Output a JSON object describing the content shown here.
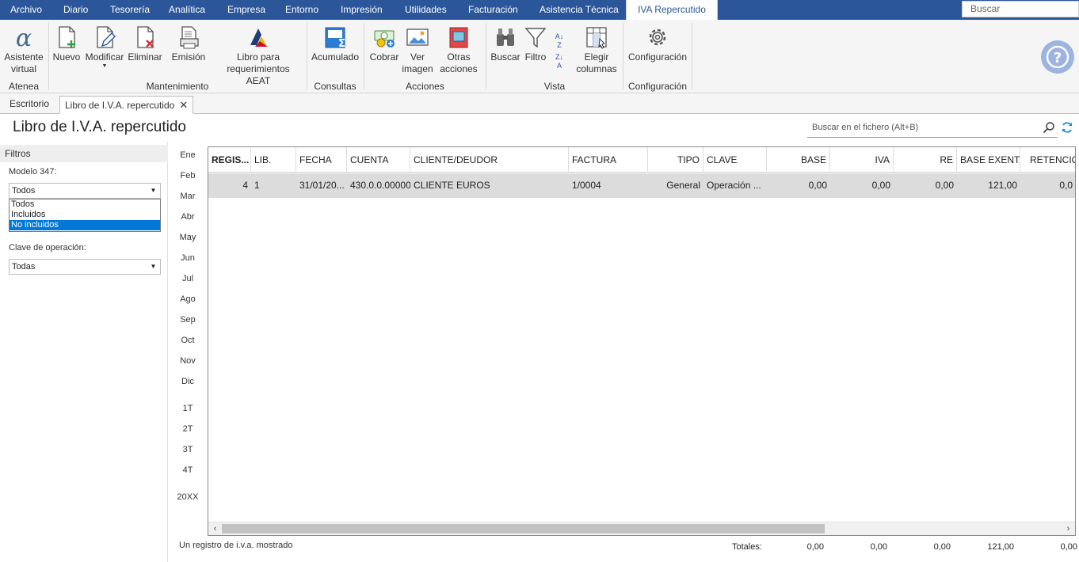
{
  "menu": {
    "items": [
      "Archivo",
      "Diario",
      "Tesorería",
      "Analítica",
      "Empresa",
      "Entorno",
      "Impresión",
      "Utilidades",
      "Facturación",
      "Asistencia Técnica"
    ],
    "active": "IVA Repercutido",
    "search_placeholder": "Buscar"
  },
  "ribbon": {
    "asistente": "Asistente virtual",
    "nuevo": "Nuevo",
    "modificar": "Modificar",
    "eliminar": "Eliminar",
    "emision": "Emisión",
    "libro_aeat": "Libro para requerimientos AEAT",
    "acumulado": "Acumulado",
    "cobrar": "Cobrar",
    "ver_imagen": "Ver imagen",
    "otras_acciones": "Otras acciones",
    "buscar": "Buscar",
    "filtro": "Filtro",
    "elegir_columnas": "Elegir columnas",
    "configuracion": "Configuración",
    "groups": {
      "atenea": "Atenea",
      "mantenimiento": "Mantenimiento",
      "consultas": "Consultas",
      "acciones": "Acciones",
      "vista": "Vista",
      "configuracion": "Configuración"
    }
  },
  "tabs": {
    "escritorio": "Escritorio",
    "libro": "Libro de I.V.A. repercutido"
  },
  "page": {
    "title": "Libro de I.V.A. repercutido",
    "file_search": "Buscar en el fichero (Alt+B)"
  },
  "filters": {
    "header": "Filtros",
    "modelo_label": "Modelo 347:",
    "modelo_value": "Todos",
    "modelo_options": [
      "Todos",
      "Incluidos",
      "No incluidos"
    ],
    "clave_label": "Clave de operación:",
    "clave_value": "Todas"
  },
  "months": [
    "Ene",
    "Feb",
    "Mar",
    "Abr",
    "May",
    "Jun",
    "Jul",
    "Ago",
    "Sep",
    "Oct",
    "Nov",
    "Dic"
  ],
  "quarters": [
    "1T",
    "2T",
    "3T",
    "4T"
  ],
  "year": "20XX",
  "grid": {
    "headers": [
      "REGIS...",
      "LIB.",
      "FECHA",
      "CUENTA",
      "CLIENTE/DEUDOR",
      "FACTURA",
      "TIPO",
      "CLAVE",
      "BASE",
      "IVA",
      "RE",
      "BASE EXENTA",
      "RETENCIÓN"
    ],
    "row": [
      "4",
      "1",
      "31/01/20...",
      "430.0.0.00000",
      "CLIENTE EUROS",
      "1/0004",
      "General",
      "Operación ...",
      "0,00",
      "0,00",
      "0,00",
      "121,00",
      "0,0"
    ]
  },
  "footer": {
    "count": "Un registro de i.v.a. mostrado",
    "totals_label": "Totales:",
    "totals": [
      "0,00",
      "0,00",
      "0,00",
      "121,00",
      "0,00"
    ]
  },
  "colors": {
    "accent": "#2b579a",
    "selection": "#0078d7",
    "row": "#dcdcdc"
  }
}
